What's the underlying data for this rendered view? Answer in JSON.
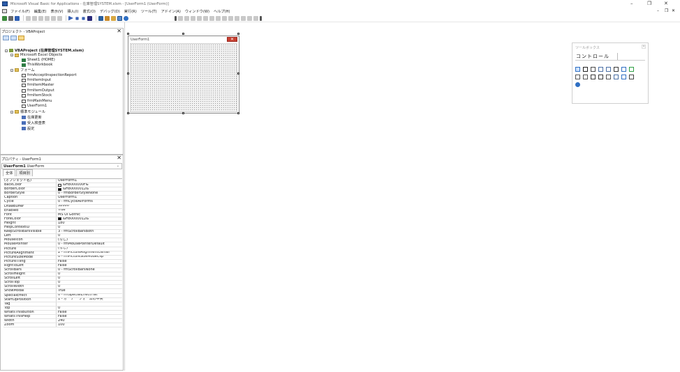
{
  "titlebar": {
    "title": "Microsoft Visual Basic for Applications - 在庫管理SYSTEM.xlsm - [UserForm1 (UserForm)]",
    "minimize": "–",
    "restore": "❐",
    "close": "✕",
    "doc_minimize": "–",
    "doc_restore": "❐",
    "doc_close": "✕"
  },
  "menubar": {
    "items": [
      "ファイル(F)",
      "編集(E)",
      "表示(V)",
      "挿入(I)",
      "書式(O)",
      "デバッグ(D)",
      "実行(R)",
      "ツール(T)",
      "アドイン(A)",
      "ウィンドウ(W)",
      "ヘルプ(H)"
    ]
  },
  "project_pane": {
    "title": "プロジェクト - VBAProject",
    "close": "✕",
    "tree": [
      {
        "label": "VBAProject (在庫管理SYSTEM.xlsm)",
        "icon": "vba-project-icon"
      },
      {
        "label": "Microsoft Excel Objects",
        "icon": "folder-icon"
      },
      {
        "label": "Sheet1 (HOME)",
        "icon": "sheet-icon"
      },
      {
        "label": "ThisWorkbook",
        "icon": "workbook-icon"
      },
      {
        "label": "フォーム",
        "icon": "folder-icon"
      },
      {
        "label": "frmAcceptInspectionReport",
        "icon": "form-icon"
      },
      {
        "label": "frmItemInput",
        "icon": "form-icon"
      },
      {
        "label": "frmItemMaster",
        "icon": "form-icon"
      },
      {
        "label": "frmItemOutput",
        "icon": "form-icon"
      },
      {
        "label": "frmItemStock",
        "icon": "form-icon"
      },
      {
        "label": "frmMainMenu",
        "icon": "form-icon"
      },
      {
        "label": "UserForm1",
        "icon": "form-icon"
      },
      {
        "label": "標準モジュール",
        "icon": "folder-icon"
      },
      {
        "label": "在庫更新",
        "icon": "module-icon"
      },
      {
        "label": "受入検査表",
        "icon": "module-icon"
      },
      {
        "label": "設定",
        "icon": "module-icon"
      }
    ]
  },
  "properties_pane": {
    "title": "プロパティ - UserForm1",
    "close": "✕",
    "object_combo": {
      "name": "UserForm1",
      "type": "UserForm",
      "arrow": "⌄"
    },
    "tabs": [
      "全体",
      "項目別"
    ],
    "rows": [
      {
        "k": "(オブジェクト名)",
        "v": "UserForm1"
      },
      {
        "k": "BackColor",
        "v": "&H8000000F&",
        "swatch": "#f0f0f0"
      },
      {
        "k": "BorderColor",
        "v": "&H80000012&",
        "swatch": "#000000"
      },
      {
        "k": "BorderStyle",
        "v": "0 - fmBorderStyleNone"
      },
      {
        "k": "Caption",
        "v": "UserForm1"
      },
      {
        "k": "Cycle",
        "v": "0 - fmCycleAllForms"
      },
      {
        "k": "DrawBuffer",
        "v": "32000"
      },
      {
        "k": "Enabled",
        "v": "True"
      },
      {
        "k": "Font",
        "v": "MS UI Gothic"
      },
      {
        "k": "ForeColor",
        "v": "&H80000012&",
        "swatch": "#000000"
      },
      {
        "k": "Height",
        "v": "180"
      },
      {
        "k": "HelpContextID",
        "v": "0"
      },
      {
        "k": "KeepScrollBarsVisible",
        "v": "3 - fmScrollBarsBoth"
      },
      {
        "k": "Left",
        "v": "0"
      },
      {
        "k": "MouseIcon",
        "v": "(なし)"
      },
      {
        "k": "MousePointer",
        "v": "0 - fmMousePointerDefault"
      },
      {
        "k": "Picture",
        "v": "(なし)"
      },
      {
        "k": "PictureAlignment",
        "v": "2 - fmPictureAlignmentCenter"
      },
      {
        "k": "PictureSizeMode",
        "v": "0 - fmPictureSizeModeClip"
      },
      {
        "k": "PictureTiling",
        "v": "False"
      },
      {
        "k": "RightToLeft",
        "v": "False"
      },
      {
        "k": "ScrollBars",
        "v": "0 - fmScrollBarsNone"
      },
      {
        "k": "ScrollHeight",
        "v": "0"
      },
      {
        "k": "ScrollLeft",
        "v": "0"
      },
      {
        "k": "ScrollTop",
        "v": "0"
      },
      {
        "k": "ScrollWidth",
        "v": "0"
      },
      {
        "k": "ShowModal",
        "v": "True"
      },
      {
        "k": "SpecialEffect",
        "v": "0 - fmSpecialEffectFlat"
      },
      {
        "k": "StartUpPosition",
        "v": "1 - オーナー フォームの中央"
      },
      {
        "k": "Tag",
        "v": ""
      },
      {
        "k": "Top",
        "v": "0"
      },
      {
        "k": "WhatsThisButton",
        "v": "False"
      },
      {
        "k": "WhatsThisHelp",
        "v": "False"
      },
      {
        "k": "Width",
        "v": "240"
      },
      {
        "k": "Zoom",
        "v": "100"
      }
    ]
  },
  "form_designer": {
    "caption": "UserForm1",
    "close": "✕"
  },
  "toolbox": {
    "title": "ツールボックス",
    "close": "✕",
    "tab": "コントロール",
    "controls": [
      "select-objects-icon",
      "label-icon",
      "textbox-icon",
      "combobox-icon",
      "listbox-icon",
      "checkbox-icon",
      "optionbutton-icon",
      "togglebutton-icon",
      "frame-icon",
      "commandbutton-icon",
      "tabstrip-icon",
      "multipage-icon",
      "scrollbar-icon",
      "spinbutton-icon",
      "image-icon",
      "refedit-icon",
      "calendar-icon"
    ]
  }
}
